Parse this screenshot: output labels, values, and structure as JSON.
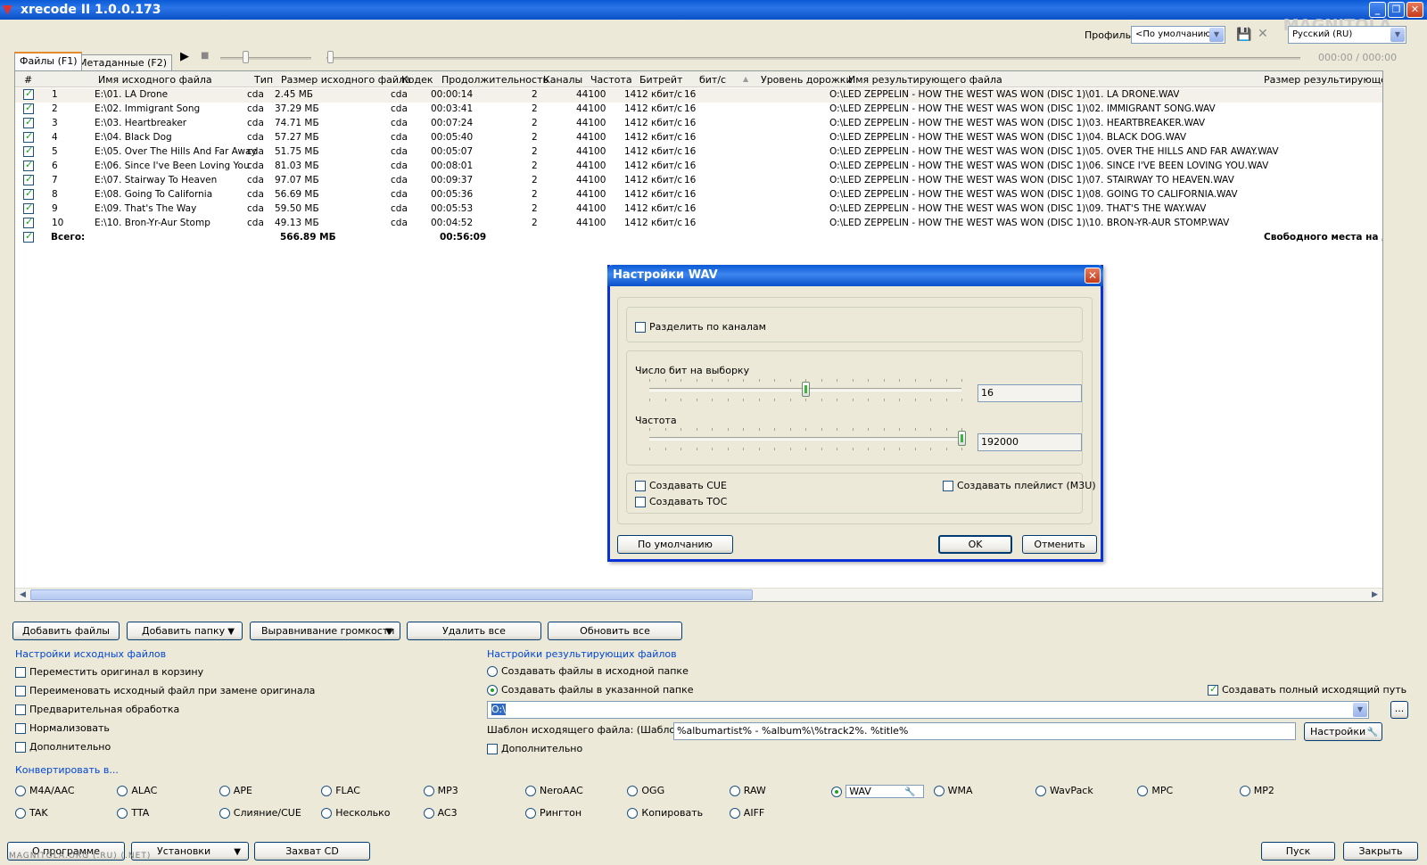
{
  "window": {
    "title": "xrecode II 1.0.0.173",
    "watermark": "MAGNITOLA"
  },
  "toolbar": {
    "profile_label": "Профиль",
    "profile_value": "<По умолчанию>",
    "language_value": "Русский (RU)",
    "time_display": "000:00 / 000:00"
  },
  "tabs": [
    {
      "label": "Файлы (F1)"
    },
    {
      "label": "Метаданные (F2)"
    }
  ],
  "grid": {
    "headers": {
      "num": "#",
      "src_name": "Имя исходного файла",
      "type": "Тип",
      "src_size": "Размер исходного файла",
      "codec": "Кодек",
      "duration": "Продолжительность",
      "channels": "Каналы",
      "freq": "Частота",
      "bitrate": "Битрейт",
      "bits": "бит/с",
      "level": "Уровень дорожки",
      "dst_name": "Имя результирующего файла",
      "dst_size": "Размер результирующего файла"
    },
    "rows": [
      {
        "n": "1",
        "name": "E:\\01. LA Drone",
        "type": "cda",
        "size": "2.45 МБ",
        "codec": "cda",
        "dur": "00:00:14",
        "ch": "2",
        "freq": "44100",
        "br": "1412 кбит/с",
        "bits": "16",
        "dst": "O:\\LED ZEPPELIN - HOW THE WEST WAS WON (DISC 1)\\01. LA DRONE.WAV"
      },
      {
        "n": "2",
        "name": "E:\\02. Immigrant Song",
        "type": "cda",
        "size": "37.29 МБ",
        "codec": "cda",
        "dur": "00:03:41",
        "ch": "2",
        "freq": "44100",
        "br": "1412 кбит/с",
        "bits": "16",
        "dst": "O:\\LED ZEPPELIN - HOW THE WEST WAS WON (DISC 1)\\02. IMMIGRANT SONG.WAV"
      },
      {
        "n": "3",
        "name": "E:\\03. Heartbreaker",
        "type": "cda",
        "size": "74.71 МБ",
        "codec": "cda",
        "dur": "00:07:24",
        "ch": "2",
        "freq": "44100",
        "br": "1412 кбит/с",
        "bits": "16",
        "dst": "O:\\LED ZEPPELIN - HOW THE WEST WAS WON (DISC 1)\\03. HEARTBREAKER.WAV"
      },
      {
        "n": "4",
        "name": "E:\\04. Black Dog",
        "type": "cda",
        "size": "57.27 МБ",
        "codec": "cda",
        "dur": "00:05:40",
        "ch": "2",
        "freq": "44100",
        "br": "1412 кбит/с",
        "bits": "16",
        "dst": "O:\\LED ZEPPELIN - HOW THE WEST WAS WON (DISC 1)\\04. BLACK DOG.WAV"
      },
      {
        "n": "5",
        "name": "E:\\05. Over The Hills And Far Away",
        "type": "cda",
        "size": "51.75 МБ",
        "codec": "cda",
        "dur": "00:05:07",
        "ch": "2",
        "freq": "44100",
        "br": "1412 кбит/с",
        "bits": "16",
        "dst": "O:\\LED ZEPPELIN - HOW THE WEST WAS WON (DISC 1)\\05. OVER THE HILLS AND FAR AWAY.WAV"
      },
      {
        "n": "6",
        "name": "E:\\06. Since I've Been Loving You",
        "type": "cda",
        "size": "81.03 МБ",
        "codec": "cda",
        "dur": "00:08:01",
        "ch": "2",
        "freq": "44100",
        "br": "1412 кбит/с",
        "bits": "16",
        "dst": "O:\\LED ZEPPELIN - HOW THE WEST WAS WON (DISC 1)\\06. SINCE I'VE BEEN LOVING YOU.WAV"
      },
      {
        "n": "7",
        "name": "E:\\07. Stairway To Heaven",
        "type": "cda",
        "size": "97.07 МБ",
        "codec": "cda",
        "dur": "00:09:37",
        "ch": "2",
        "freq": "44100",
        "br": "1412 кбит/с",
        "bits": "16",
        "dst": "O:\\LED ZEPPELIN - HOW THE WEST WAS WON (DISC 1)\\07. STAIRWAY TO HEAVEN.WAV"
      },
      {
        "n": "8",
        "name": "E:\\08. Going To California",
        "type": "cda",
        "size": "56.69 МБ",
        "codec": "cda",
        "dur": "00:05:36",
        "ch": "2",
        "freq": "44100",
        "br": "1412 кбит/с",
        "bits": "16",
        "dst": "O:\\LED ZEPPELIN - HOW THE WEST WAS WON (DISC 1)\\08. GOING TO CALIFORNIA.WAV"
      },
      {
        "n": "9",
        "name": "E:\\09. That's The Way",
        "type": "cda",
        "size": "59.50 МБ",
        "codec": "cda",
        "dur": "00:05:53",
        "ch": "2",
        "freq": "44100",
        "br": "1412 кбит/с",
        "bits": "16",
        "dst": "O:\\LED ZEPPELIN - HOW THE WEST WAS WON (DISC 1)\\09. THAT'S THE WAY.WAV"
      },
      {
        "n": "10",
        "name": "E:\\10. Bron-Yr-Aur Stomp",
        "type": "cda",
        "size": "49.13 МБ",
        "codec": "cda",
        "dur": "00:04:52",
        "ch": "2",
        "freq": "44100",
        "br": "1412 кбит/с",
        "bits": "16",
        "dst": "O:\\LED ZEPPELIN - HOW THE WEST WAS WON (DISC 1)\\10. BRON-YR-AUR STOMP.WAV"
      }
    ],
    "total": {
      "label": "Всего:",
      "size": "566.89 МБ",
      "dur": "00:56:09",
      "free_space": "Свободного места на диске O"
    }
  },
  "actions": {
    "add_files": "Добавить файлы",
    "add_folder": "Добавить папку",
    "normalize": "Выравнивание громкости",
    "remove_all": "Удалить все",
    "refresh_all": "Обновить все"
  },
  "source_settings": {
    "title": "Настройки исходных файлов",
    "options": [
      {
        "label": "Переместить оригинал в корзину",
        "checked": false
      },
      {
        "label": "Переименовать исходный файл при замене оригинала",
        "checked": false
      },
      {
        "label": "Предварительная обработка",
        "checked": false
      },
      {
        "label": "Нормализовать",
        "checked": false
      },
      {
        "label": "Дополнительно",
        "checked": false
      }
    ]
  },
  "dest_settings": {
    "title": "Настройки результирующих файлов",
    "opt_source_folder": "Создавать файлы в исходной папке",
    "opt_target_folder": "Создавать файлы в указанной папке",
    "opt_full_path": "Создавать полный исходящий путь",
    "path_value": "O:\\",
    "browse_label": "...",
    "template_label": "Шаблон исходящего файла: (Шаблон CD)",
    "template_value": "%albumartist% - %album%\\%track2%. %title%",
    "settings_button": "Настройки",
    "extra": "Дополнительно"
  },
  "convert": {
    "title": "Конвертировать в...",
    "row1": [
      "M4A/AAC",
      "ALAC",
      "APE",
      "FLAC",
      "MP3",
      "NeroAAC",
      "OGG",
      "RAW",
      "WAV",
      "WMA",
      "WavPack",
      "MPC",
      "MP2"
    ],
    "row2": [
      "TAK",
      "TTA",
      "Слияние/CUE",
      "Несколько",
      "AC3",
      "Рингтон",
      "Копировать",
      "AIFF"
    ],
    "selected": "WAV"
  },
  "footer": {
    "about": "О программе",
    "settings": "Установки",
    "capture_cd": "Захват CD",
    "start": "Пуск",
    "close": "Закрыть",
    "watermark": "MAGNITOLA.ORG (.RU) (.NET)"
  },
  "dialog": {
    "title": "Настройки WAV",
    "split_channels": "Разделить по каналам",
    "bits_label": "Число бит на выборку",
    "bits_value": "16",
    "bits_slider_fraction": 0.5,
    "freq_label": "Частота",
    "freq_value": "192000",
    "freq_slider_fraction": 1.0,
    "create_cue": "Создавать CUE",
    "create_toc": "Создавать TOC",
    "create_playlist": "Создавать плейлист (M3U)",
    "default_button": "По умолчанию",
    "ok_button": "OK",
    "cancel_button": "Отменить"
  }
}
